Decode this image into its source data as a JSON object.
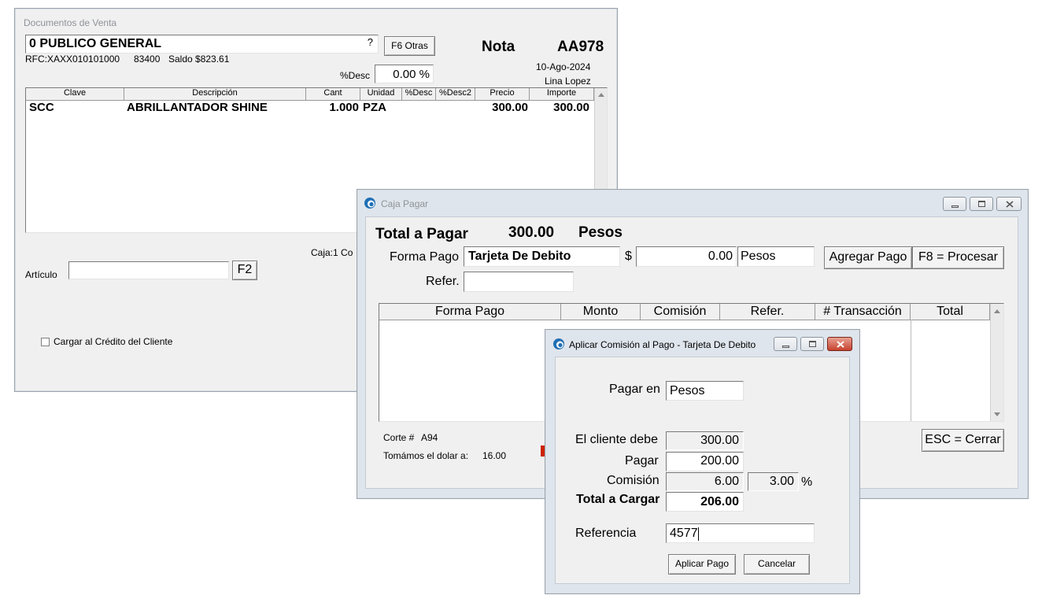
{
  "ventas": {
    "title": "Documentos de Venta",
    "customer": "0 PUBLICO GENERAL",
    "help_btn": "?",
    "f6_btn": "F6 Otras",
    "doc_type": "Nota",
    "doc_number": "AA978",
    "rfc": "RFC:XAXX010101000",
    "zip": "83400",
    "saldo": "Saldo $823.61",
    "date": "10-Ago-2024",
    "user": "Lina Lopez",
    "desc_label": "%Desc",
    "desc_value": "0.00 %",
    "columns": [
      "Clave",
      "Descripción",
      "Cant",
      "Unidad",
      "%Desc",
      "%Desc2",
      "Precio",
      "Importe"
    ],
    "rows": [
      {
        "clave": "SCC",
        "descripcion": "ABRILLANTADOR SHINE",
        "cant": "1.000",
        "unidad": "PZA",
        "desc": "",
        "desc2": "",
        "precio": "300.00",
        "importe": "300.00"
      }
    ],
    "caja": "Caja:1  Co",
    "articulo_label": "Artículo",
    "f2_btn": "F2",
    "credito_label": "Cargar al Crédito del Cliente"
  },
  "caja_pagar": {
    "title": "Caja Pagar",
    "total_label": "Total a Pagar",
    "total_value": "300.00",
    "currency": "Pesos",
    "forma_pago_label": "Forma Pago",
    "forma_pago_value": "Tarjeta De Debito",
    "dollar_sign": "$",
    "monto_value": "0.00",
    "monto_currency": "Pesos",
    "agregar_btn": "Agregar Pago",
    "procesar_btn": "F8 = Procesar",
    "refer_label": "Refer.",
    "refer_value": "",
    "columns": [
      "Forma Pago",
      "Monto",
      "Comisión",
      "Refer.",
      "# Transacción",
      "Total"
    ],
    "corte_label": "Corte #",
    "corte_value": "A94",
    "dolar_label": "Tomámos el dolar a:",
    "dolar_value": "16.00",
    "cerrar_btn": "ESC = Cerrar"
  },
  "comision": {
    "title": "Aplicar Comisión al Pago - Tarjeta De Debito",
    "pagar_en_label": "Pagar en",
    "pagar_en_value": "Pesos",
    "debe_label": "El cliente debe",
    "debe_value": "300.00",
    "pagar_label": "Pagar",
    "pagar_value": "200.00",
    "comision_label": "Comisión",
    "comision_value": "6.00",
    "comision_pct": "3.00",
    "pct_sign": "%",
    "total_label": "Total a Cargar",
    "total_value": "206.00",
    "referencia_label": "Referencia",
    "referencia_value": "4577",
    "aplicar_btn": "Aplicar Pago",
    "cancelar_btn": "Cancelar"
  },
  "colors": {
    "close_red": "#c7422f",
    "window_bg": "#f0f0f0",
    "accent_red": "#cc2200"
  }
}
